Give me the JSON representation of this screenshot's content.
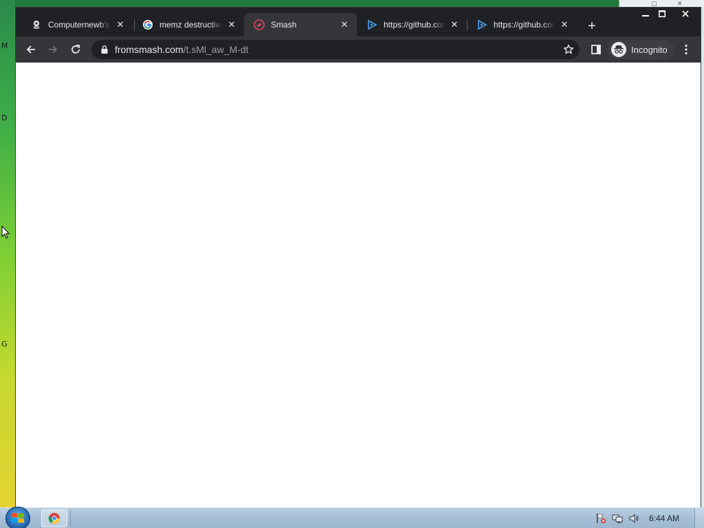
{
  "desktop": {
    "left_letters": [
      "M",
      "D",
      "G"
    ]
  },
  "browser": {
    "tabs": [
      {
        "title": "Computernewb's Internet",
        "icon": "computernewb-icon",
        "active": false
      },
      {
        "title": "memz destructive",
        "icon": "google-icon",
        "active": false
      },
      {
        "title": "Smash",
        "icon": "smash-icon",
        "active": true
      },
      {
        "title": "https://github.com",
        "icon": "play-icon",
        "active": false
      },
      {
        "title": "https://github.com",
        "icon": "play-icon",
        "active": false
      }
    ],
    "new_tab_label": "+",
    "omnibox": {
      "host": "fromsmash.com",
      "path": "/t.sMl_aw_M-dt"
    },
    "profile_label": "Incognito",
    "colors": {
      "frame": "#202124",
      "toolbar": "#35363a",
      "text": "#e8eaed"
    }
  },
  "taskbar": {
    "clock": "6:44 AM",
    "pinned": [
      "chrome-icon"
    ],
    "tray": [
      "action-center-flag-icon",
      "network-icon",
      "volume-icon"
    ]
  }
}
